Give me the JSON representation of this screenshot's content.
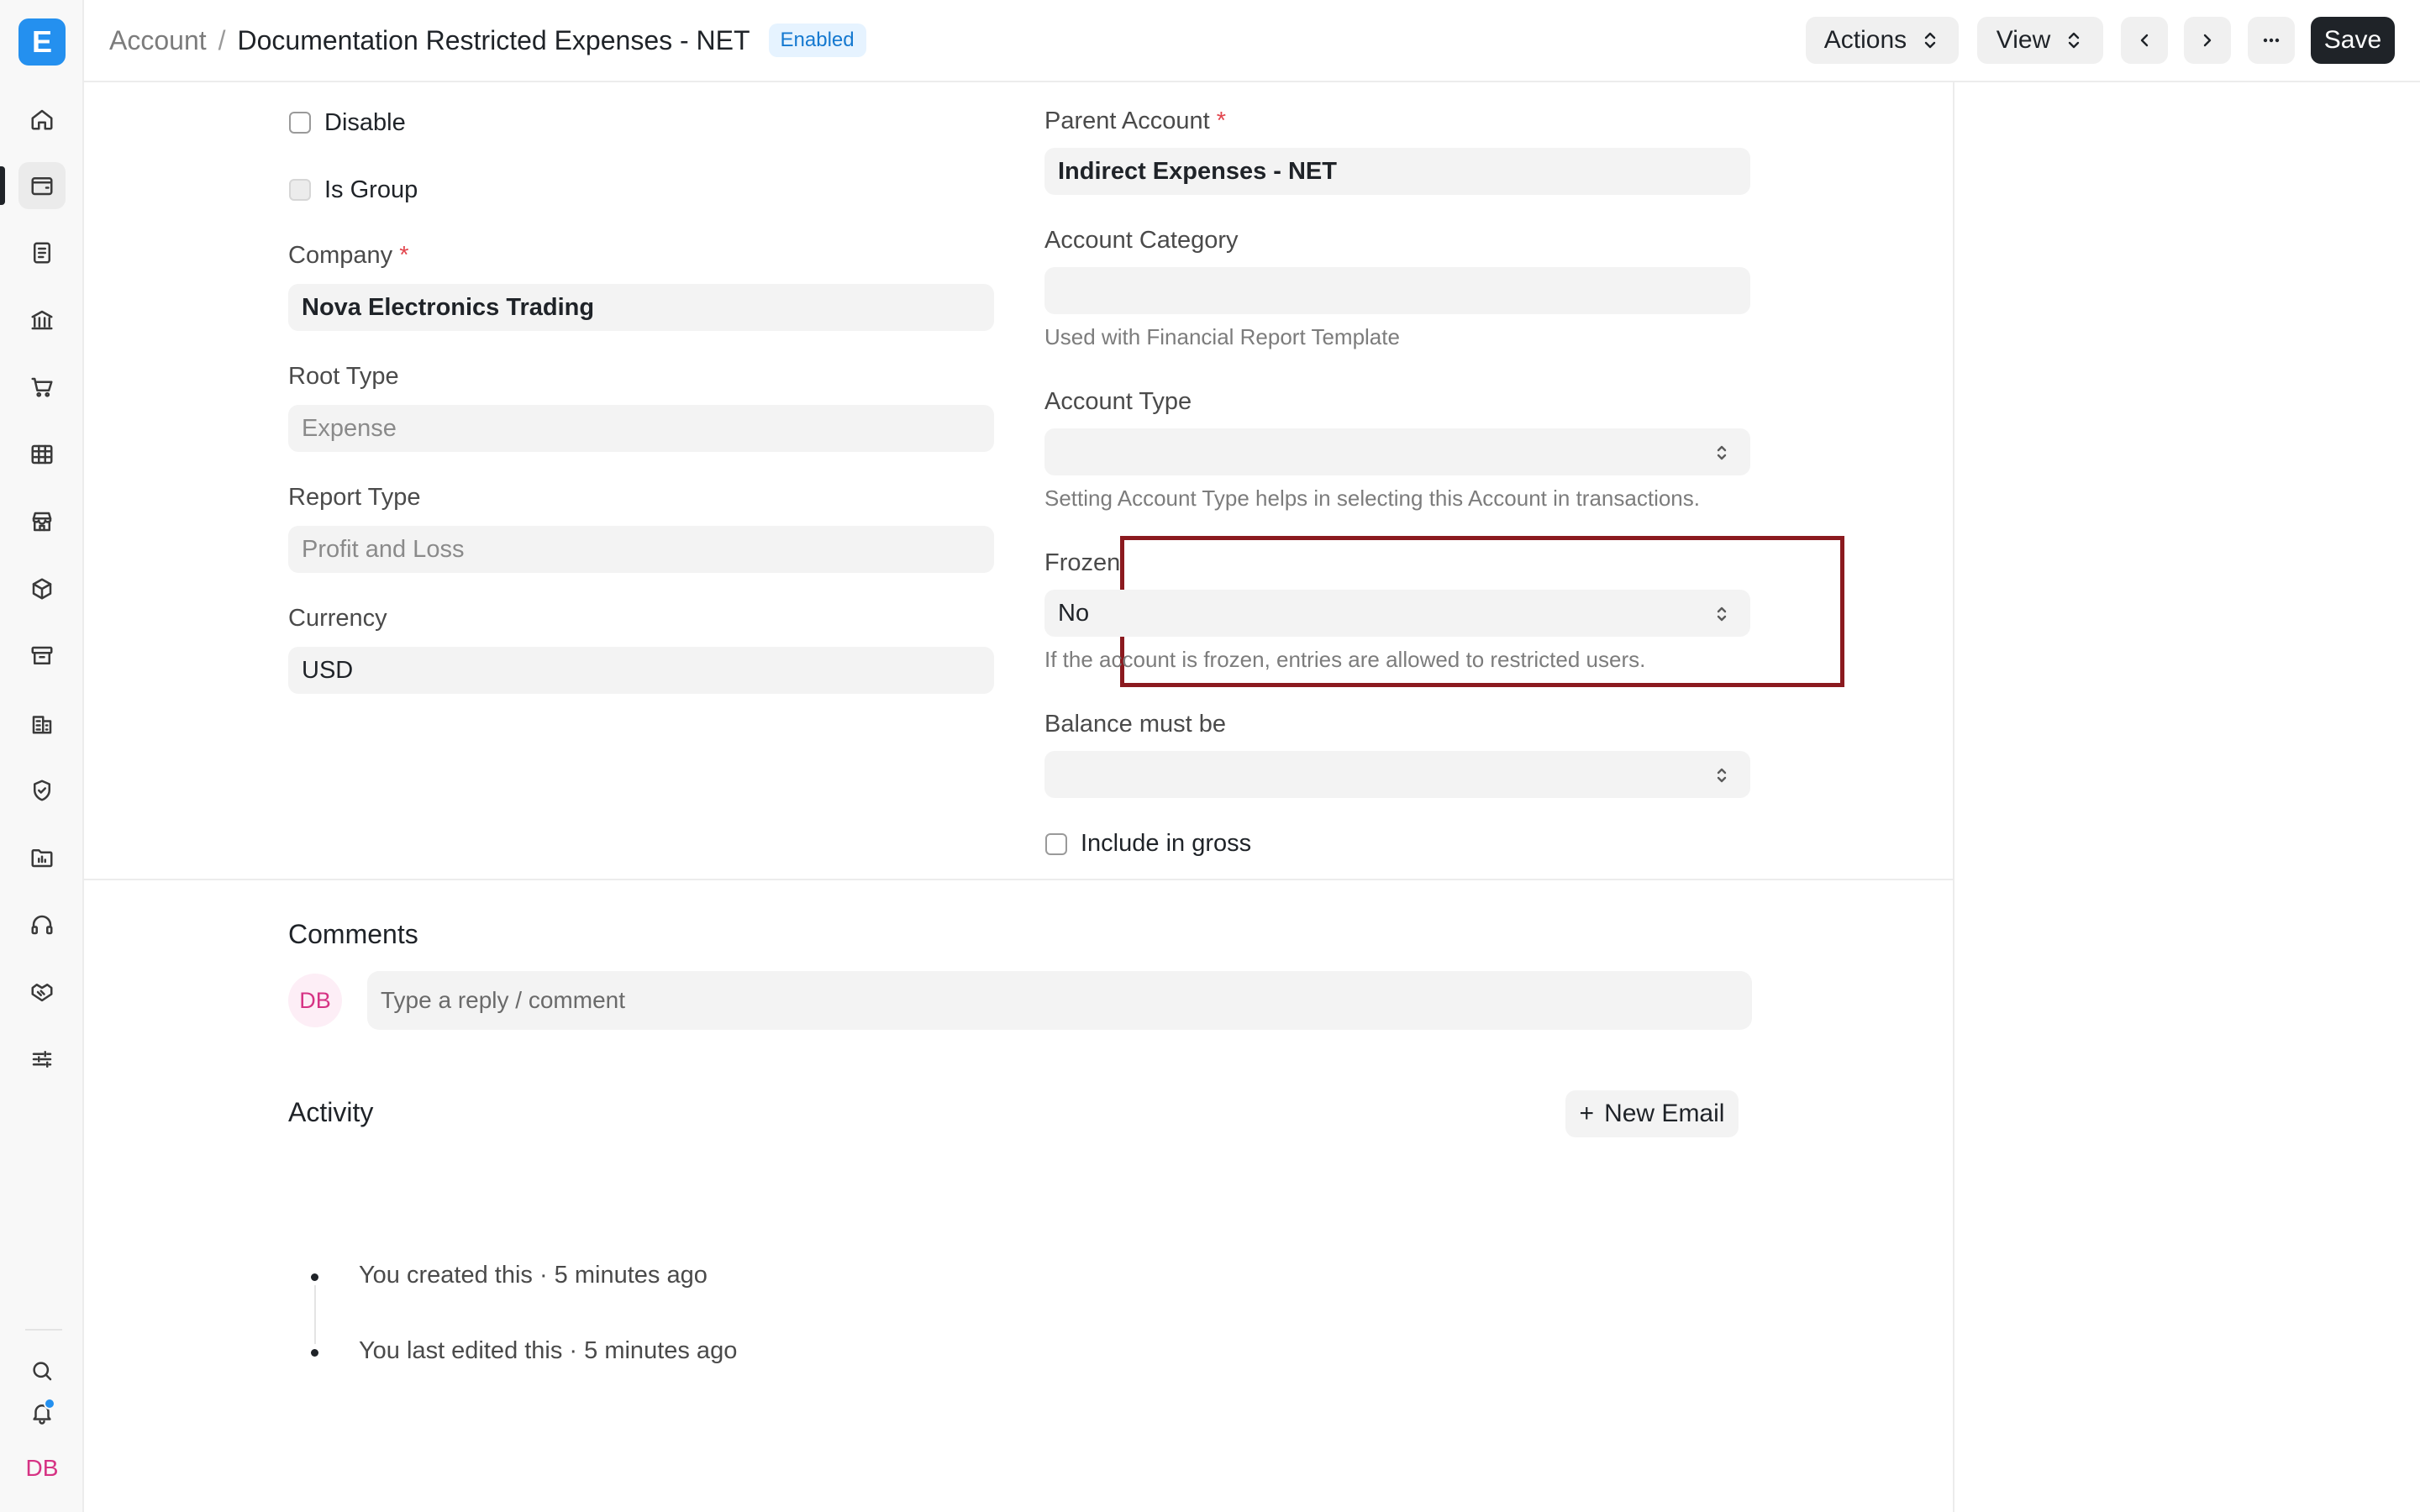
{
  "app": {
    "logo_letter": "E"
  },
  "sidebar": {
    "items": [
      {
        "name": "home-icon"
      },
      {
        "name": "accounting-icon",
        "active": true
      },
      {
        "name": "invoice-icon"
      },
      {
        "name": "bank-icon"
      },
      {
        "name": "cart-icon"
      },
      {
        "name": "table-icon"
      },
      {
        "name": "store-icon"
      },
      {
        "name": "package-icon"
      },
      {
        "name": "archive-icon"
      },
      {
        "name": "building-icon"
      },
      {
        "name": "shield-icon"
      },
      {
        "name": "folder-chart-icon"
      },
      {
        "name": "headset-icon"
      },
      {
        "name": "handshake-icon"
      },
      {
        "name": "sliders-icon"
      }
    ],
    "bottom": {
      "search": "search-icon",
      "notifications": "bell-icon",
      "avatar_initials": "DB"
    }
  },
  "header": {
    "breadcrumb_parent": "Account",
    "separator": "/",
    "title": "Documentation Restricted Expenses - NET",
    "status_badge": "Enabled",
    "actions_label": "Actions",
    "view_label": "View",
    "save_label": "Save"
  },
  "form": {
    "disable": {
      "label": "Disable",
      "checked": false
    },
    "is_group": {
      "label": "Is Group",
      "checked": false,
      "disabled": true
    },
    "company": {
      "label": "Company",
      "required_mark": "*",
      "value": "Nova Electronics Trading"
    },
    "root_type": {
      "label": "Root Type",
      "value": "Expense"
    },
    "report_type": {
      "label": "Report Type",
      "value": "Profit and Loss"
    },
    "currency": {
      "label": "Currency",
      "value": "USD"
    },
    "parent_account": {
      "label": "Parent Account",
      "required_mark": "*",
      "value": "Indirect Expenses - NET"
    },
    "account_category": {
      "label": "Account Category",
      "value": "",
      "help": "Used with Financial Report Template"
    },
    "account_type": {
      "label": "Account Type",
      "value": "",
      "help": "Setting Account Type helps in selecting this Account in transactions."
    },
    "frozen": {
      "label": "Frozen",
      "value": "No",
      "help": "If the account is frozen, entries are allowed to restricted users."
    },
    "balance_must_be": {
      "label": "Balance must be",
      "value": ""
    },
    "include_in_gross": {
      "label": "Include in gross",
      "checked": false
    }
  },
  "comments": {
    "title": "Comments",
    "avatar_initials": "DB",
    "placeholder": "Type a reply / comment"
  },
  "activity": {
    "title": "Activity",
    "new_email_label": "New Email",
    "items": [
      {
        "text": "You created this · 5 minutes ago"
      },
      {
        "text": "You last edited this · 5 minutes ago"
      }
    ]
  },
  "colors": {
    "accent": "#2490ef",
    "highlight_border": "#8b1a1f",
    "avatar_pink": "#d63384",
    "badge_bg": "#e6f3ff",
    "badge_text": "#1579d0"
  }
}
